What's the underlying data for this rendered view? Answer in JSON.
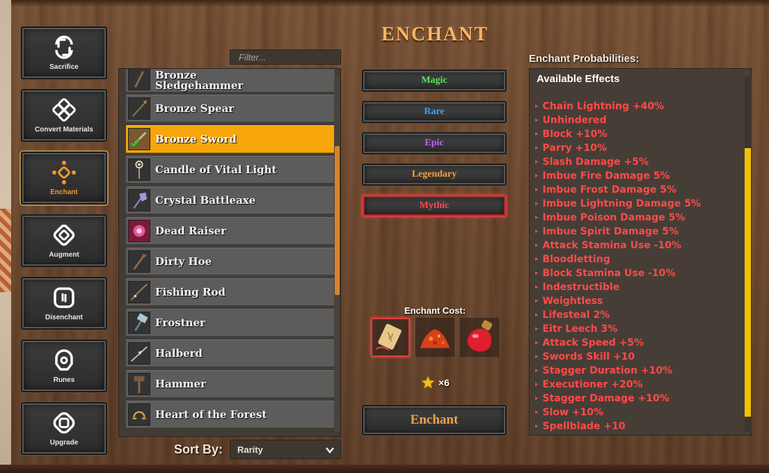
{
  "title": "ENCHANT",
  "sidebar": {
    "items": [
      {
        "label": "Sacrifice",
        "icon": "sacrifice-icon"
      },
      {
        "label": "Convert Materials",
        "icon": "convert-materials-icon"
      },
      {
        "label": "Enchant",
        "icon": "enchant-icon",
        "active": true
      },
      {
        "label": "Augment",
        "icon": "augment-icon"
      },
      {
        "label": "Disenchant",
        "icon": "disenchant-icon"
      },
      {
        "label": "Runes",
        "icon": "runes-icon"
      },
      {
        "label": "Upgrade",
        "icon": "upgrade-icon"
      }
    ]
  },
  "filter": {
    "placeholder": "Filter..."
  },
  "items": [
    {
      "name": "Bronze Sledgehammer",
      "line1": "Bronze",
      "line2": "Sledgehammer"
    },
    {
      "name": "Bronze Spear"
    },
    {
      "name": "Bronze Sword",
      "selected": true
    },
    {
      "name": "Candle of Vital Light"
    },
    {
      "name": "Crystal Battleaxe"
    },
    {
      "name": "Dead Raiser"
    },
    {
      "name": "Dirty Hoe"
    },
    {
      "name": "Fishing Rod"
    },
    {
      "name": "Frostner"
    },
    {
      "name": "Halberd"
    },
    {
      "name": "Hammer"
    },
    {
      "name": "Heart of the Forest"
    }
  ],
  "sort": {
    "label": "Sort By:",
    "value": "Rarity"
  },
  "rarities": [
    {
      "label": "Magic",
      "color": "#5ee05e"
    },
    {
      "label": "Rare",
      "color": "#3aa0ff"
    },
    {
      "label": "Epic",
      "color": "#c15cff"
    },
    {
      "label": "Legendary",
      "color": "#f0a040"
    },
    {
      "label": "Mythic",
      "color": "#ff4a4a",
      "selected": true
    }
  ],
  "cost": {
    "label": "Enchant Cost:",
    "slots": [
      "rune-scroll-icon",
      "red-dust-icon",
      "red-potion-icon"
    ],
    "star_quantity": "×6"
  },
  "enchant_button": "Enchant",
  "probabilities": {
    "title": "Enchant Probabilities:",
    "heading": "Available Effects",
    "effects": [
      "Chain Lightning +40%",
      "Unhindered",
      "Block +10%",
      "Parry +10%",
      "Slash Damage +5%",
      "Imbue Fire Damage 5%",
      "Imbue Frost Damage 5%",
      "Imbue Lightning Damage 5%",
      "Imbue Poison Damage 5%",
      "Imbue Spirit Damage 5%",
      "Attack Stamina Use -10%",
      "Bloodletting",
      "Block Stamina Use -10%",
      "Indestructible",
      "Weightless",
      "Lifesteal 2%",
      "Eitr Leech 3%",
      "Attack Speed +5%",
      "Swords Skill +10",
      "Stagger Duration +10%",
      "Executioner +20%",
      "Stagger Damage +10%",
      "Slow +10%",
      "Spellblade +10"
    ]
  }
}
